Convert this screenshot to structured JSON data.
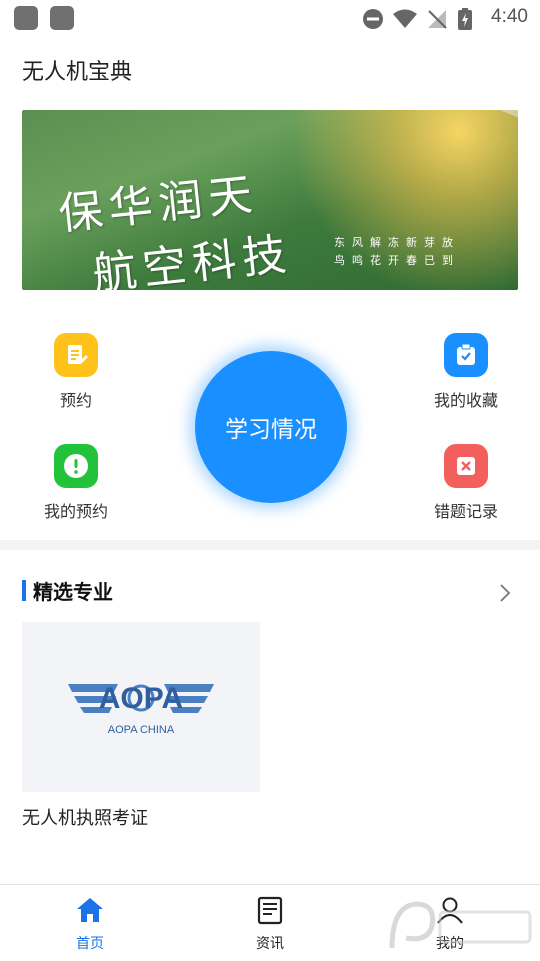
{
  "status": {
    "time": "4:40"
  },
  "app": {
    "title": "无人机宝典"
  },
  "banner": {
    "line1": "保华润天",
    "line2": "航空科技",
    "poem1": "东风解冻新芽放",
    "poem2": "鸟鸣花开春已到"
  },
  "quick": {
    "booking": "预约",
    "favorites": "我的收藏",
    "my_booking": "我的预约",
    "mistakes": "错题记录",
    "study": "学习情况"
  },
  "section": {
    "title": "精选专业"
  },
  "course": {
    "title": "无人机执照考证",
    "logo_text": "AOPA",
    "logo_sub": "AOPA CHINA"
  },
  "tabs": {
    "home": "首页",
    "news": "资讯",
    "mine": "我的"
  },
  "colors": {
    "accent": "#1a8fff",
    "tab_active": "#1a73e8"
  }
}
